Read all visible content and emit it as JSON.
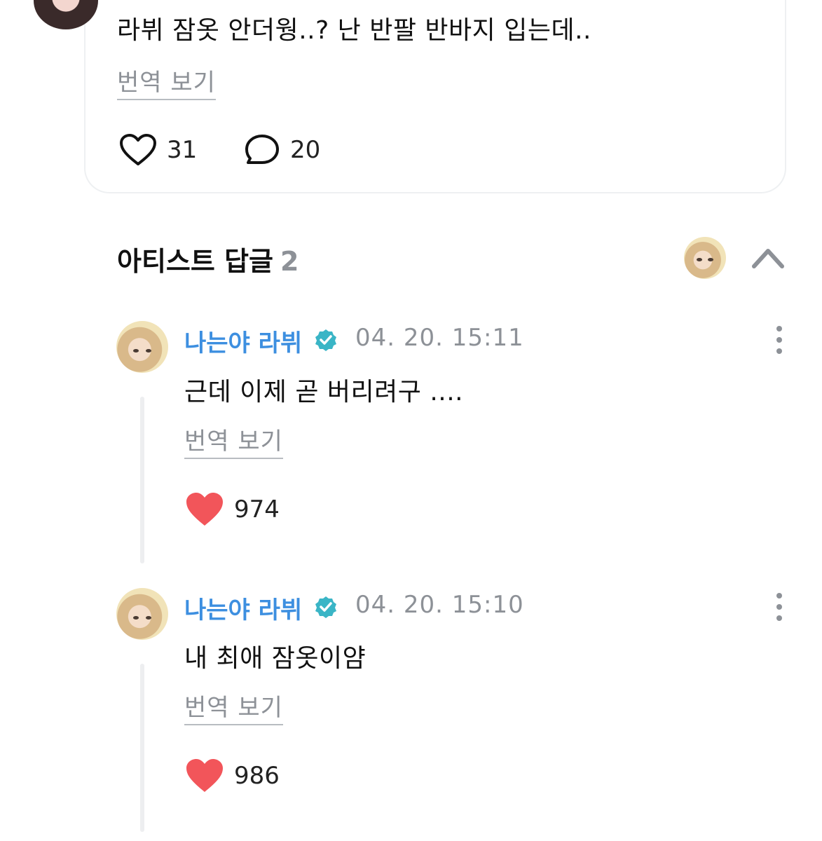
{
  "post": {
    "text": "라뷔 잠옷 안더웡..? 난 반팔 반바지 입는데..",
    "translate_label": "번역 보기",
    "like_count": "31",
    "comment_count": "20"
  },
  "artist_replies": {
    "title": "아티스트 답글",
    "count": "2",
    "items": [
      {
        "author": "나는야 라뷔",
        "time": "04. 20. 15:11",
        "text": "근데 이제 곧 버리려구 ....",
        "translate_label": "번역 보기",
        "like_count": "974"
      },
      {
        "author": "나는야 라뷔",
        "time": "04. 20. 15:10",
        "text": "내 최애 잠옷이얌",
        "translate_label": "번역 보기",
        "like_count": "986"
      }
    ]
  },
  "colors": {
    "author_blue": "#3d8fe0",
    "verified_teal": "#3ab5c6",
    "heart_red": "#f2555a",
    "muted_gray": "#8d9197"
  },
  "icons": [
    "heart-outline-icon",
    "comment-bubble-icon",
    "chevron-up-icon",
    "verified-badge-icon",
    "heart-filled-icon",
    "more-vertical-icon"
  ]
}
